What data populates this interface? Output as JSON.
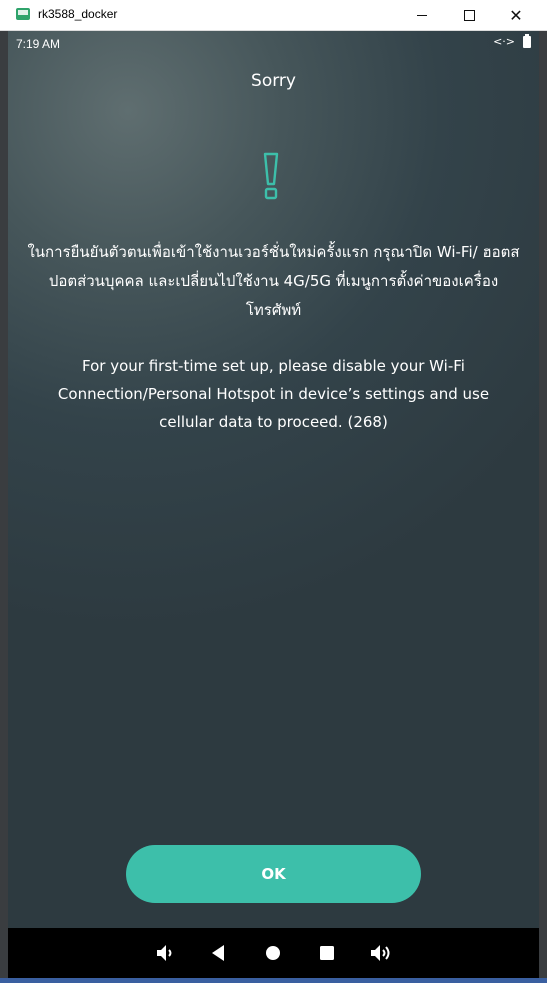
{
  "window": {
    "title": "rk3588_docker",
    "minimize_label": "",
    "maximize_label": "",
    "close_label": "✕"
  },
  "statusbar": {
    "time": "7:19 AM",
    "arrows": "<·>"
  },
  "dialog": {
    "title": "Sorry",
    "icon": "exclamation-icon",
    "thai_message": "ในการยืนยันตัวตนเพื่อเข้าใช้งานเวอร์ชั่นใหม่ครั้งแรก กรุณาปิด Wi-Fi/ ฮอตสปอตส่วนบุคคล และเปลี่ยนไปใช้งาน 4G/5G ที่เมนูการตั้งค่าของเครื่องโทรศัพท์",
    "english_message": "For your first-time set up, please disable your Wi-Fi Connection/Personal Hotspot in device’s settings and use cellular data to proceed. (268)",
    "ok_label": "OK"
  },
  "navbar": {
    "buttons": [
      "volume-down-icon",
      "back-icon",
      "home-icon",
      "recents-icon",
      "volume-up-icon"
    ]
  },
  "colors": {
    "accent": "#3dbfaa",
    "text": "#ffffff"
  }
}
